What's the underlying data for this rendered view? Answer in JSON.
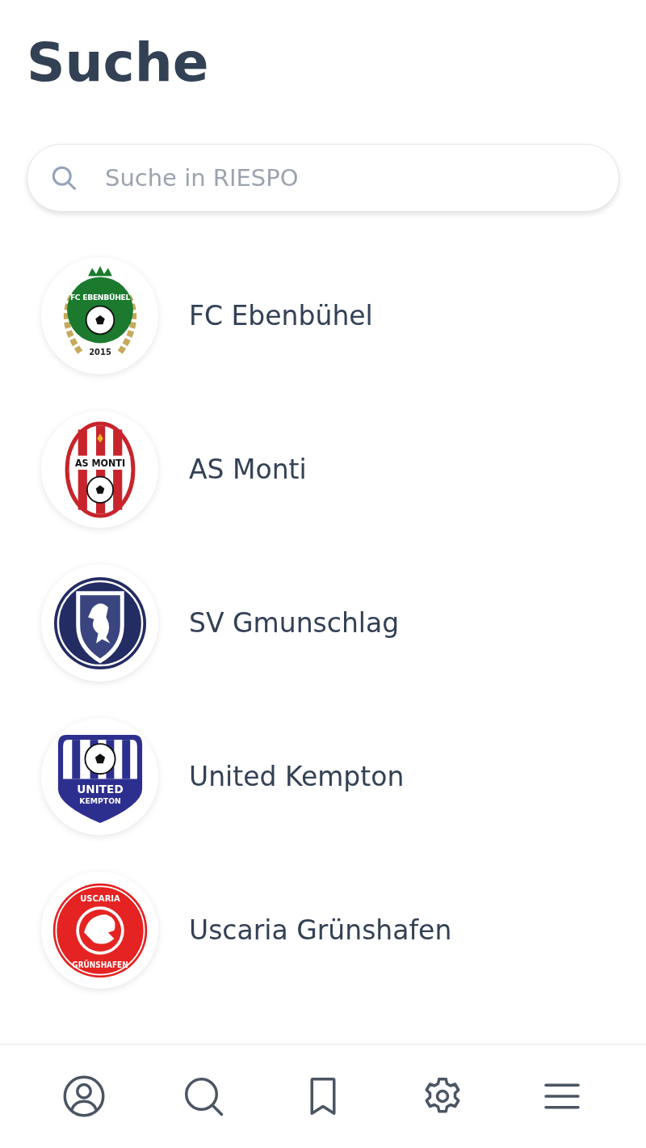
{
  "header": {
    "title": "Suche"
  },
  "search": {
    "placeholder": "Suche in RIESPO"
  },
  "clubs": [
    {
      "name": "FC Ebenbühel",
      "crest": {
        "kind": "laurel",
        "lines": [
          "FC EBENBÜHEL",
          "2015"
        ]
      }
    },
    {
      "name": "AS Monti",
      "crest": {
        "kind": "oval",
        "lines": [
          "AS MONTI"
        ]
      }
    },
    {
      "name": "SV Gmunschlag",
      "crest": {
        "kind": "lion-shield"
      }
    },
    {
      "name": "United Kempton",
      "crest": {
        "kind": "striped-shield",
        "lines": [
          "UNITED",
          "KEMPTON"
        ]
      }
    },
    {
      "name": "Uscaria Grünshafen",
      "crest": {
        "kind": "roundel",
        "lines": [
          "USCARIA",
          "GRÜNSHAFEN"
        ]
      }
    }
  ],
  "nav": [
    {
      "kind": "profile"
    },
    {
      "kind": "search"
    },
    {
      "kind": "bookmark"
    },
    {
      "kind": "settings"
    },
    {
      "kind": "menu"
    }
  ]
}
